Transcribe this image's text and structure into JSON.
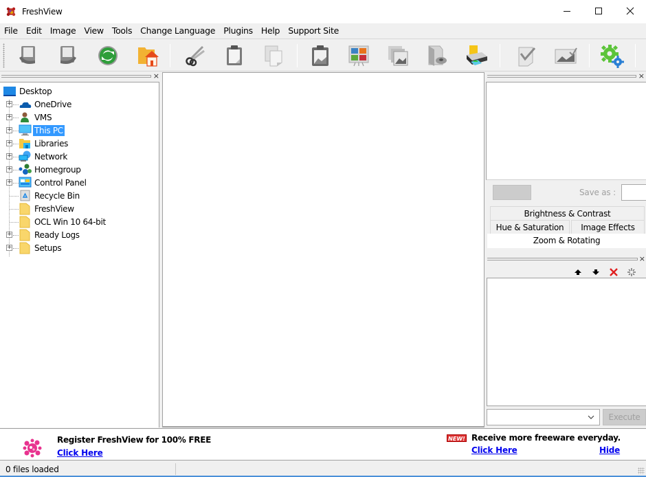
{
  "window": {
    "title": "FreshView",
    "controls": {
      "minimize": "minimize",
      "maximize": "maximize",
      "close": "close"
    }
  },
  "menu": {
    "items": [
      "File",
      "Edit",
      "Image",
      "View",
      "Tools",
      "Change Language",
      "Plugins",
      "Help",
      "Support Site"
    ]
  },
  "toolbar": {
    "buttons": [
      {
        "icon": "rotate-left-icon",
        "tooltip": "Rotate Left"
      },
      {
        "icon": "rotate-right-icon",
        "tooltip": "Rotate Right"
      },
      {
        "icon": "refresh-icon",
        "tooltip": "Refresh"
      },
      {
        "icon": "home-folder-icon",
        "tooltip": "Home"
      },
      {
        "icon": "cut-icon",
        "tooltip": "Cut"
      },
      {
        "icon": "paste-icon",
        "tooltip": "Paste"
      },
      {
        "icon": "copy-icon",
        "tooltip": "Copy"
      },
      {
        "icon": "clipboard-image-icon",
        "tooltip": "Clipboard Image"
      },
      {
        "icon": "slideshow-icon",
        "tooltip": "Slideshow"
      },
      {
        "icon": "gallery-icon",
        "tooltip": "Gallery"
      },
      {
        "icon": "save-disk-icon",
        "tooltip": "Save"
      },
      {
        "icon": "print-icon",
        "tooltip": "Print"
      },
      {
        "icon": "checkmark-icon",
        "tooltip": "Select"
      },
      {
        "icon": "image-check-icon",
        "tooltip": "Image Select"
      },
      {
        "icon": "settings-gears-icon",
        "tooltip": "Settings"
      }
    ]
  },
  "tree": {
    "items": [
      {
        "label": "Desktop",
        "icon": "desktop-icon",
        "level": 0,
        "expandable": false,
        "selected": false
      },
      {
        "label": "OneDrive",
        "icon": "onedrive-icon",
        "level": 1,
        "expandable": true,
        "selected": false
      },
      {
        "label": "VMS",
        "icon": "user-icon",
        "level": 1,
        "expandable": true,
        "selected": false
      },
      {
        "label": "This PC",
        "icon": "computer-icon",
        "level": 1,
        "expandable": true,
        "selected": true
      },
      {
        "label": "Libraries",
        "icon": "libraries-icon",
        "level": 1,
        "expandable": true,
        "selected": false
      },
      {
        "label": "Network",
        "icon": "network-icon",
        "level": 1,
        "expandable": true,
        "selected": false
      },
      {
        "label": "Homegroup",
        "icon": "homegroup-icon",
        "level": 1,
        "expandable": true,
        "selected": false
      },
      {
        "label": "Control Panel",
        "icon": "control-panel-icon",
        "level": 1,
        "expandable": true,
        "selected": false
      },
      {
        "label": "Recycle Bin",
        "icon": "recycle-bin-icon",
        "level": 1,
        "expandable": false,
        "selected": false
      },
      {
        "label": "FreshView",
        "icon": "folder-icon",
        "level": 1,
        "expandable": false,
        "selected": false
      },
      {
        "label": "OCL Win 10 64-bit",
        "icon": "folder-icon",
        "level": 1,
        "expandable": false,
        "selected": false
      },
      {
        "label": "Ready Logs",
        "icon": "folder-icon",
        "level": 1,
        "expandable": true,
        "selected": false
      },
      {
        "label": "Setups",
        "icon": "folder-icon",
        "level": 1,
        "expandable": true,
        "selected": false
      }
    ]
  },
  "right_panel": {
    "save_as_label": "Save as :",
    "save_as_value": "",
    "tabs": {
      "row1": [
        "Brightness & Contrast"
      ],
      "row2": [
        "Hue & Saturation",
        "Image Effects"
      ],
      "row3": [
        "Zoom & Rotating"
      ],
      "active": "Zoom & Rotating"
    },
    "list_actions": [
      "move-up-icon",
      "move-down-icon",
      "delete-icon",
      "clear-icon"
    ],
    "combo_value": "",
    "execute_label": "Execute"
  },
  "adbar": {
    "title": "Register FreshView for 100% FREE",
    "click_here": "Click Here",
    "new_badge": "NEW!",
    "right_title": "Receive more freeware everyday.",
    "right_click_here": "Click Here",
    "hide": "Hide"
  },
  "status": {
    "text": "0 files loaded"
  },
  "colors": {
    "selection": "#3399ff",
    "link": "#0000ee",
    "delete": "#e02020"
  }
}
